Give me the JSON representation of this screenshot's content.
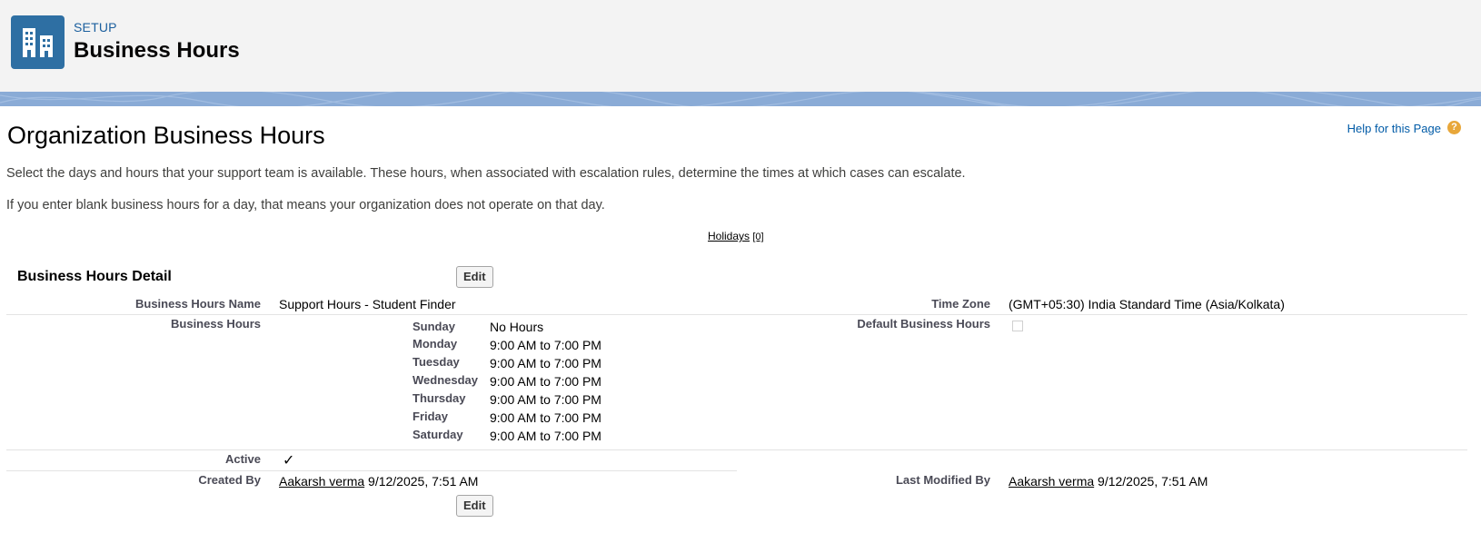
{
  "header": {
    "setup_label": "SETUP",
    "title": "Business Hours",
    "icon": "building-icon"
  },
  "help": {
    "label": "Help for this Page",
    "icon": "question-icon",
    "icon_glyph": "?"
  },
  "page": {
    "title": "Organization Business Hours",
    "description_1": "Select the days and hours that your support team is available. These hours, when associated with escalation rules, determine the times at which cases can escalate.",
    "description_2": "If you enter blank business hours for a day, that means your organization does not operate on that day.",
    "holidays_label": "Holidays",
    "holidays_count": "[0]"
  },
  "detail": {
    "section_title": "Business Hours Detail",
    "edit_label": "Edit",
    "name_label": "Business Hours Name",
    "name_value": "Support Hours - Student Finder",
    "timezone_label": "Time Zone",
    "timezone_value": "(GMT+05:30) India Standard Time (Asia/Kolkata)",
    "hours_label": "Business Hours",
    "default_label": "Default Business Hours",
    "default_checked": false,
    "days": [
      {
        "day": "Sunday",
        "hours": "No Hours"
      },
      {
        "day": "Monday",
        "hours": "9:00 AM to 7:00 PM"
      },
      {
        "day": "Tuesday",
        "hours": "9:00 AM to 7:00 PM"
      },
      {
        "day": "Wednesday",
        "hours": "9:00 AM to 7:00 PM"
      },
      {
        "day": "Thursday",
        "hours": "9:00 AM to 7:00 PM"
      },
      {
        "day": "Friday",
        "hours": "9:00 AM to 7:00 PM"
      },
      {
        "day": "Saturday",
        "hours": "9:00 AM to 7:00 PM"
      }
    ],
    "active_label": "Active",
    "active_mark": "✓",
    "created_label": "Created By",
    "created_user": "Aakarsh verma",
    "created_date": "9/12/2025, 7:51 AM",
    "modified_label": "Last Modified By",
    "modified_user": "Aakarsh verma",
    "modified_date": "9/12/2025, 7:51 AM"
  },
  "colors": {
    "brand": "#2e6fa3",
    "link": "#015ba7",
    "banner": "#8aabd6",
    "help_icon": "#e8a73a"
  }
}
